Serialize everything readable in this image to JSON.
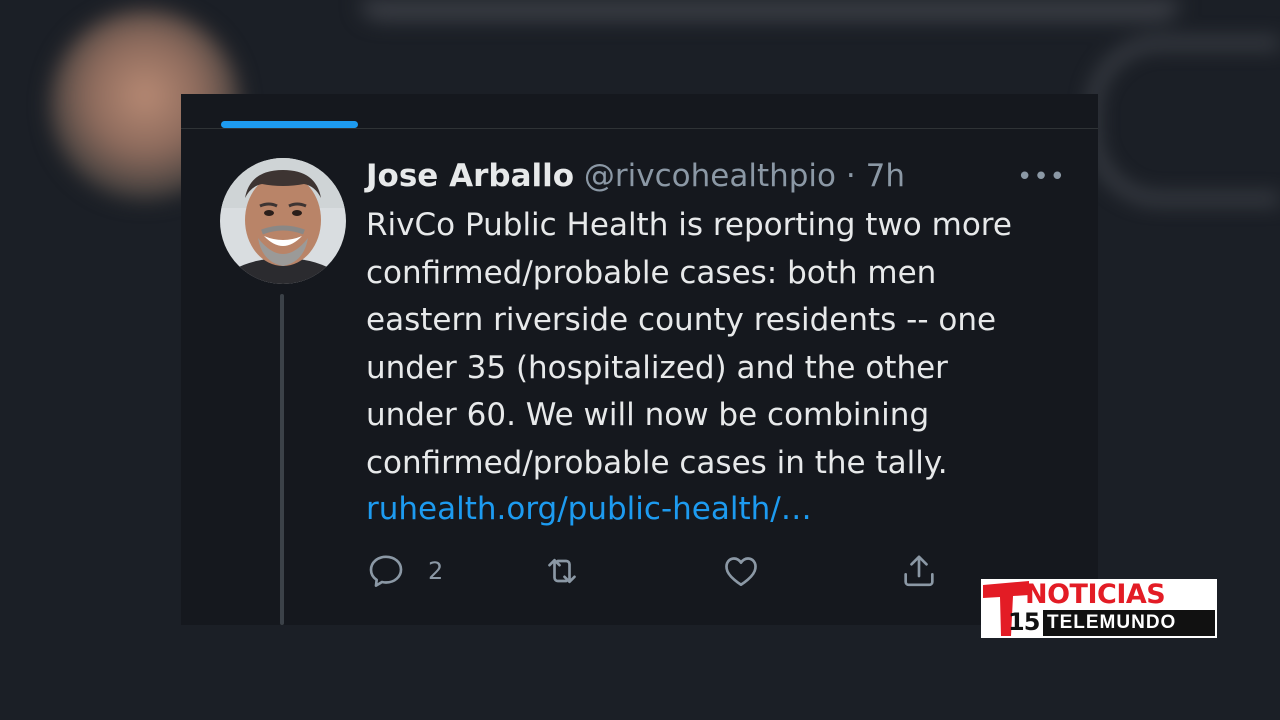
{
  "tweet": {
    "author_name": "Jose Arballo",
    "handle": "@rivcohealthpio",
    "separator": "·",
    "time": "7h",
    "more_glyph": "•••",
    "body_lines": [
      "RivCo Public Health is reporting two more",
      "confirmed/probable cases: both men",
      "eastern riverside county residents -- one",
      "under 35 (hospitalized) and the other",
      "under 60. We will now be combining",
      "confirmed/probable cases in the tally."
    ],
    "link": "ruhealth.org/public-health/…",
    "reply_count": "2",
    "icons": [
      "reply-icon",
      "retweet-icon",
      "like-icon",
      "share-icon"
    ],
    "accent": "#1d9bf0"
  },
  "logo": {
    "word1": "NOTICIAS",
    "number": "15",
    "word2": "TELEMUNDO",
    "brand_red": "#e31c25"
  }
}
